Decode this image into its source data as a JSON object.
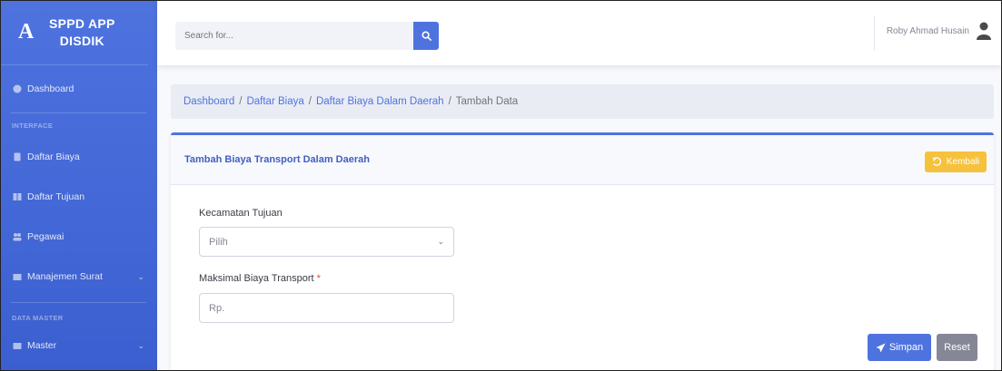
{
  "sidebar": {
    "brand_logo": "A",
    "brand_line1": "SPPD APP",
    "brand_line2": "DISDIK",
    "dashboard": "Dashboard",
    "heading_interface": "INTERFACE",
    "items": [
      {
        "label": "Daftar Biaya",
        "icon": "document-icon"
      },
      {
        "label": "Daftar Tujuan",
        "icon": "book-icon"
      },
      {
        "label": "Pegawai",
        "icon": "users-icon"
      },
      {
        "label": "Manajemen Surat",
        "icon": "folder-icon"
      }
    ],
    "heading_master": "DATA MASTER",
    "master": "Master"
  },
  "topbar": {
    "search_placeholder": "Search for...",
    "user_name": "Roby Ahmad Husain"
  },
  "breadcrumb": {
    "items": [
      "Dashboard",
      "Daftar Biaya",
      "Daftar Biaya Dalam Daerah"
    ],
    "active": "Tambah Data"
  },
  "card": {
    "title": "Tambah Biaya Transport Dalam Daerah",
    "back_label": "Kembali"
  },
  "form": {
    "kecamatan_label": "Kecamatan Tujuan",
    "kecamatan_value": "Pilih",
    "biaya_label": "Maksimal Biaya Transport",
    "required_mark": "*",
    "biaya_placeholder": "Rp.",
    "submit_label": "Simpan",
    "reset_label": "Reset"
  },
  "colors": {
    "primary": "#4e73df",
    "warning": "#f6c23e",
    "secondary": "#858796"
  }
}
